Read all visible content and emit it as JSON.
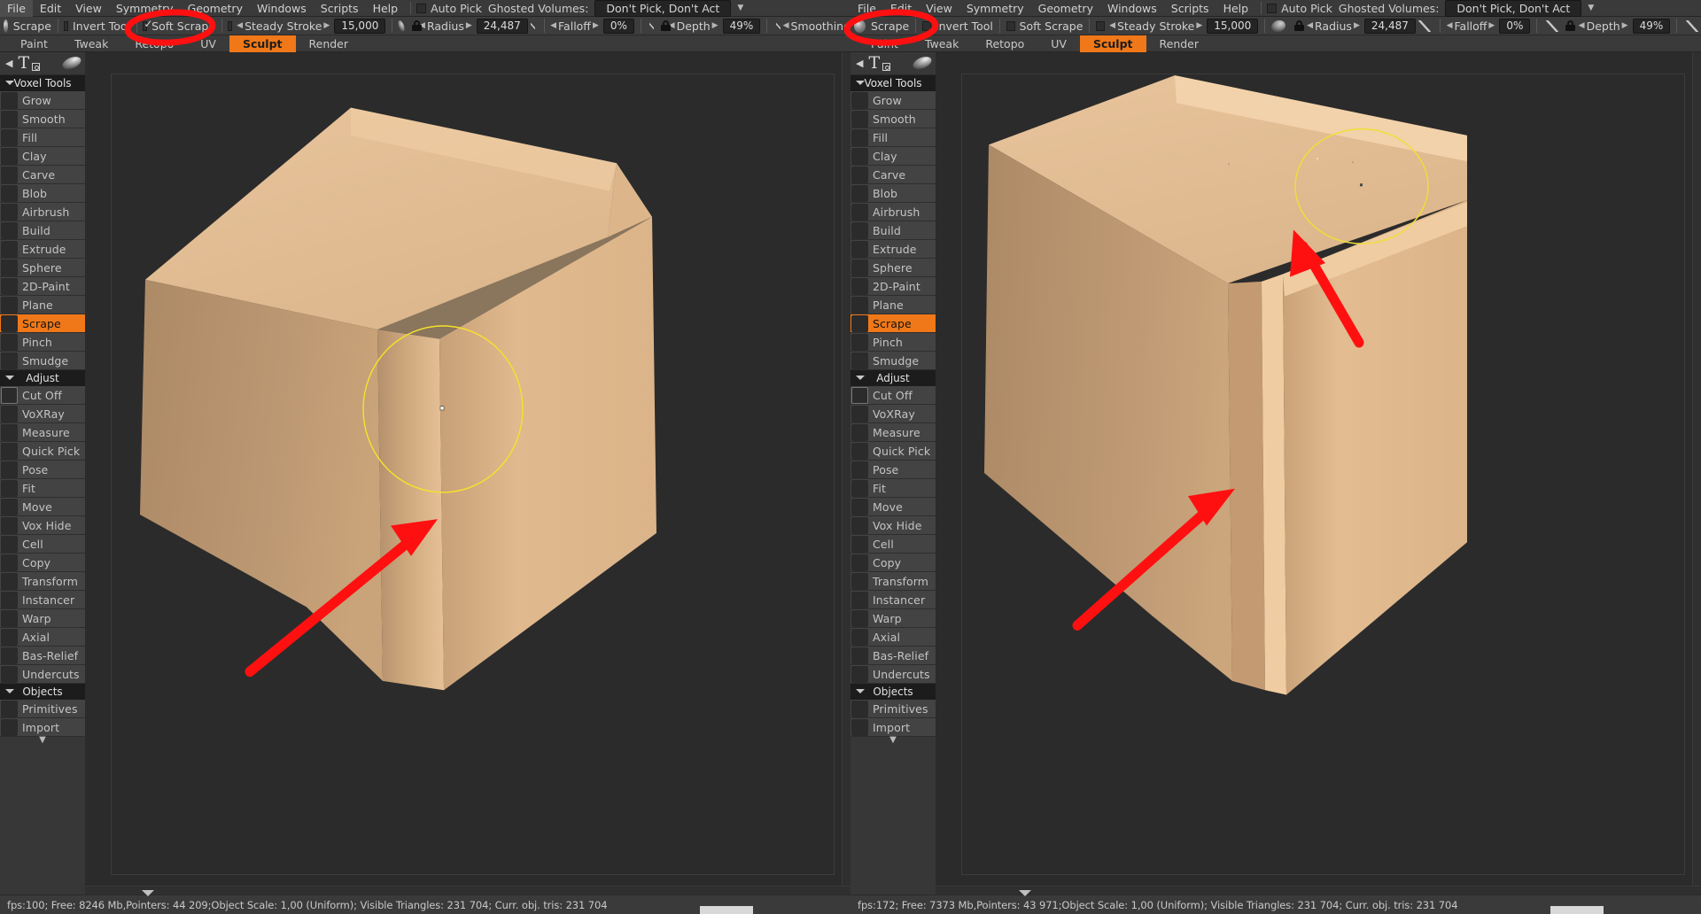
{
  "app": {
    "menu": [
      "File",
      "Edit",
      "View",
      "Symmetry",
      "Geometry",
      "Windows",
      "Scripts",
      "Help"
    ],
    "auto_pick_label": "Auto Pick",
    "ghosted_label": "Ghosted Volumes:",
    "ghosted_value": "Don't Pick, Don't Act",
    "tabs": [
      "Paint",
      "Tweak",
      "Retopo",
      "UV",
      "Sculpt",
      "Render"
    ],
    "active_tab": "Sculpt"
  },
  "toolbar": {
    "brush_name": "Scrape",
    "invert_tool": "Invert Tool",
    "soft_scrape": "Soft Scrape",
    "steady_stroke": "Steady Stroke",
    "steady_stroke_value": "15,000",
    "radius_label": "Radius",
    "radius_value": "24,487",
    "falloff_label": "Falloff",
    "falloff_value": "0%",
    "depth_label": "Depth",
    "depth_value": "49%",
    "smoothing_label": "Smoothing"
  },
  "sidebar": {
    "panel_title": "Voxel Tools",
    "groups": [
      {
        "title": "Voxel Tools",
        "items": [
          {
            "label": "Grow",
            "icon": "grow-icon",
            "cls": "ic-grow"
          },
          {
            "label": "Smooth",
            "icon": "smooth-icon",
            "cls": "ic-smooth"
          },
          {
            "label": "Fill",
            "icon": "fill-icon",
            "cls": "ic-fill"
          },
          {
            "label": "Clay",
            "icon": "clay-icon",
            "cls": "ic-swirl"
          },
          {
            "label": "Carve",
            "icon": "carve-icon",
            "cls": "ic-swirl"
          },
          {
            "label": "Blob",
            "icon": "blob-icon",
            "cls": "ic-blob"
          },
          {
            "label": "Airbrush",
            "icon": "airbrush-icon",
            "cls": "ic-sphere"
          },
          {
            "label": "Build",
            "icon": "build-icon",
            "cls": "ic-build"
          },
          {
            "label": "Extrude",
            "icon": "extrude-icon",
            "cls": "ic-extr"
          },
          {
            "label": "Sphere",
            "icon": "sphere-icon",
            "cls": "ic-sphr"
          },
          {
            "label": "2D-Paint",
            "icon": "2d-paint-icon",
            "cls": "ic-paint2d"
          },
          {
            "label": "Plane",
            "icon": "plane-icon",
            "cls": "ic-plane"
          },
          {
            "label": "Scrape",
            "icon": "scrape-icon",
            "cls": "ic-scrape",
            "selected": true
          },
          {
            "label": "Pinch",
            "icon": "pinch-icon",
            "cls": "ic-pinch"
          },
          {
            "label": "Smudge",
            "icon": "smudge-icon",
            "cls": "ic-smudge"
          }
        ]
      },
      {
        "title": "Adjust",
        "items": [
          {
            "label": "Cut Off",
            "icon": "cut-off-icon",
            "cls": "ic-cut"
          },
          {
            "label": "VoXRay",
            "icon": "voxray-icon",
            "cls": "ic-ray"
          },
          {
            "label": "Measure",
            "icon": "measure-icon",
            "cls": "ic-meas"
          },
          {
            "label": "Quick Pick",
            "icon": "quick-pick-icon",
            "cls": "ic-qpick"
          },
          {
            "label": "Pose",
            "icon": "pose-icon",
            "cls": "ic-pose"
          },
          {
            "label": "Fit",
            "icon": "fit-icon",
            "cls": "ic-fit"
          },
          {
            "label": "Move",
            "icon": "move-icon",
            "cls": "ic-move"
          },
          {
            "label": "Vox Hide",
            "icon": "vox-hide-icon",
            "cls": "ic-voxhide"
          },
          {
            "label": "Cell",
            "icon": "cell-icon",
            "cls": "ic-cell"
          },
          {
            "label": "Copy",
            "icon": "copy-icon",
            "cls": "ic-copy"
          },
          {
            "label": "Transform",
            "icon": "transform-icon",
            "cls": "ic-trans"
          },
          {
            "label": "Instancer",
            "icon": "instancer-icon",
            "cls": "ic-inst"
          },
          {
            "label": "Warp",
            "icon": "warp-icon",
            "cls": "ic-warp"
          },
          {
            "label": "Axial",
            "icon": "axial-icon",
            "cls": "ic-axial"
          },
          {
            "label": "Bas-Relief",
            "icon": "bas-relief-icon",
            "cls": "ic-bas"
          },
          {
            "label": "Undercuts",
            "icon": "undercuts-icon",
            "cls": "ic-under"
          }
        ]
      },
      {
        "title": "Objects",
        "items": [
          {
            "label": "Primitives",
            "icon": "primitives-icon",
            "cls": "ic-prim"
          },
          {
            "label": "Import",
            "icon": "import-icon",
            "cls": "ic-import"
          }
        ]
      }
    ]
  },
  "panels": {
    "left": {
      "soft_scrape_checked": true,
      "status": "fps:100;  Free: 8246 Mb,Pointers: 44 209;Object Scale: 1,00 (Uniform); Visible Triangles: 231 704; Curr. obj. tris: 231 704"
    },
    "right": {
      "soft_scrape_checked": false,
      "status": "fps:172;  Free: 7373 Mb,Pointers: 43 971;Object Scale: 1,00 (Uniform); Visible Triangles: 231 704; Curr. obj. tris: 231 704"
    }
  },
  "colors": {
    "accent": "#f07818",
    "annotation": "#ff0000",
    "brush_ring": "#f5e32a",
    "model_light": "#e4bc92",
    "model_mid": "#d6ab81",
    "model_dark": "#b7936e",
    "viewport_bg": "#2b2b2b"
  },
  "annotations": {
    "left_circle": "red-ellipse-around-soft-scrape-checkbox",
    "left_arrow": "red-arrow-pointing-at-soft-rounded-edge",
    "right_circle": "red-ellipse-around-soft-scrape-checkbox",
    "right_arrow_lower": "red-arrow-pointing-at-sharp-edge",
    "right_arrow_upper": "red-arrow-pointing-at-sharp-top-edge",
    "right_brush_ring": "yellow-brush-cursor-ellipse"
  }
}
